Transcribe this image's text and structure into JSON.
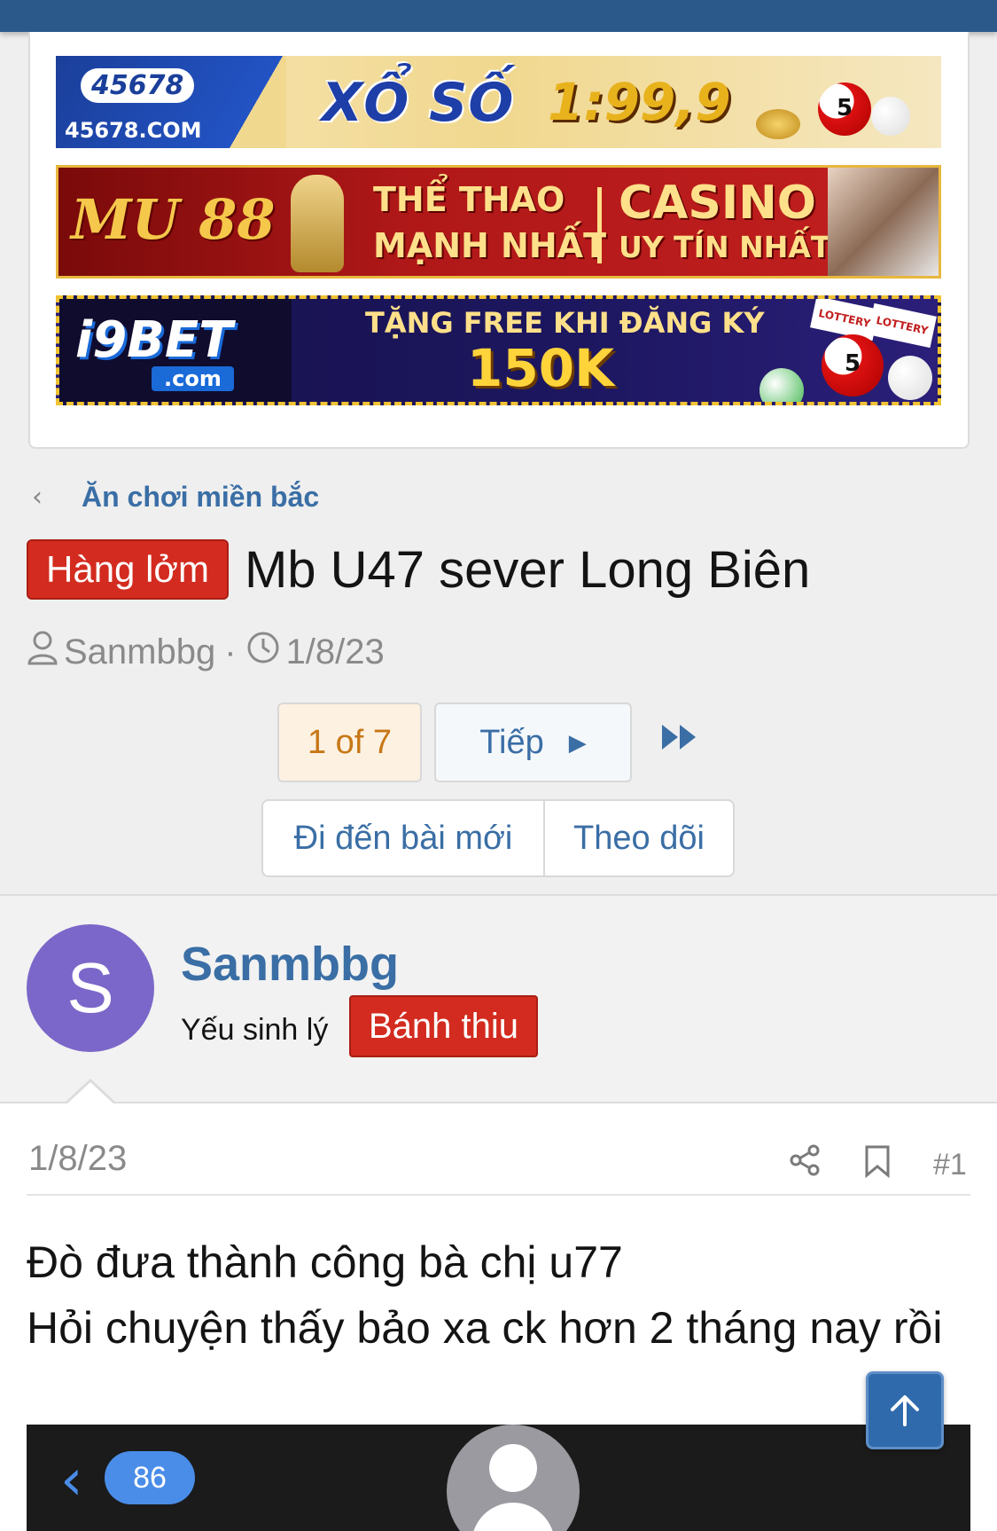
{
  "ads": [
    {
      "logo_number": "45678",
      "logo_domain": "45678.COM",
      "headline": "XỔ SỐ",
      "odds": "1:99,9",
      "ball_number": "5",
      "colors": {
        "bg": "#f1d88f",
        "accent": "#1e3ea8"
      }
    },
    {
      "brand": "MU 88",
      "line1": "THỂ THAO",
      "line2": "MẠNH NHẤT",
      "line3": "CASINO",
      "line4": "UY TÍN NHẤT",
      "colors": {
        "bg": "#b01818",
        "accent": "#ffe08a"
      }
    },
    {
      "brand": "i9BET",
      "domain": ".com",
      "line1": "TẶNG FREE KHI ĐĂNG KÝ",
      "amount": "150K",
      "ball_number": "5",
      "ticket": "LOTTERY",
      "colors": {
        "bg": "#1d1760",
        "accent": "#ffd43a"
      }
    }
  ],
  "breadcrumb": {
    "label": "Ăn chơi miền bắc",
    "icon": "chevron-left-icon"
  },
  "thread": {
    "prefix": "Hàng lởm",
    "title": "Mb U47 sever Long Biên",
    "author": "Sanmbbg",
    "separator": "·",
    "date": "1/8/23"
  },
  "pagination": {
    "current": "1 of 7",
    "next_label": "Tiếp",
    "last_icon": "fast-forward-icon"
  },
  "actions": {
    "new_posts": "Đi đến bài mới",
    "watch": "Theo dõi"
  },
  "post": {
    "user": {
      "avatar_letter": "S",
      "name": "Sanmbbg",
      "title": "Yếu sinh lý",
      "banner": "Bánh thiu",
      "avatar_color": "#7b67c9"
    },
    "date": "1/8/23",
    "number": "#1",
    "body_lines": [
      "Đò đưa thành công bà chị u77",
      "Hỏi chuyện thấy bảo xa ck hơn 2 tháng nay rồi"
    ],
    "attachment": {
      "back_count": "86"
    }
  },
  "colors": {
    "header": "#2b5a8a",
    "link": "#3a6ea5",
    "prefix": "#d32b1f"
  }
}
